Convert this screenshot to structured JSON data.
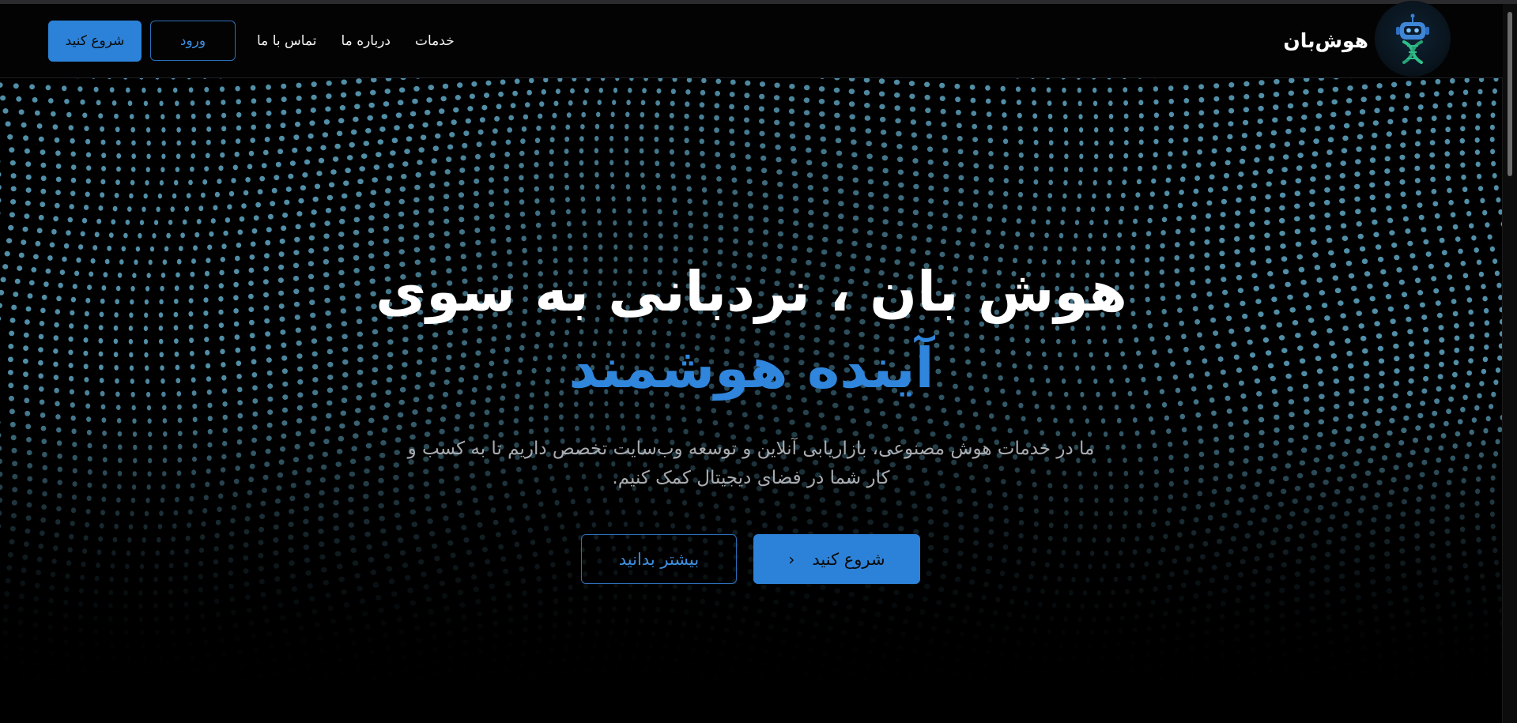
{
  "brand": {
    "name": "هوش‌بان",
    "logo_icon": "robot-icon"
  },
  "nav": {
    "links": [
      "خدمات",
      "درباره ما",
      "تماس با ما"
    ],
    "login_label": "ورود",
    "start_label": "شروع کنید"
  },
  "hero": {
    "title_line1": "هوش بان ، نردبانی به سوی",
    "title_line2": "آینده هوشمند",
    "subtitle": "ما در خدمات هوش مصنوعی، بازاریابی آنلاین و توسعه وب‌سایت تخصص داریم تا به کسب و کار شما در فضای دیجیتال کمک کنیم.",
    "primary_button": "شروع کنید",
    "primary_icon": "chevron-left-icon",
    "secondary_button": "بیشتر بدانید"
  },
  "colors": {
    "accent": "#2c82d8",
    "accent_text": "#2f86dc",
    "background": "#000000",
    "dot": "#5fa7c4",
    "subtitle": "#a9acb1"
  }
}
